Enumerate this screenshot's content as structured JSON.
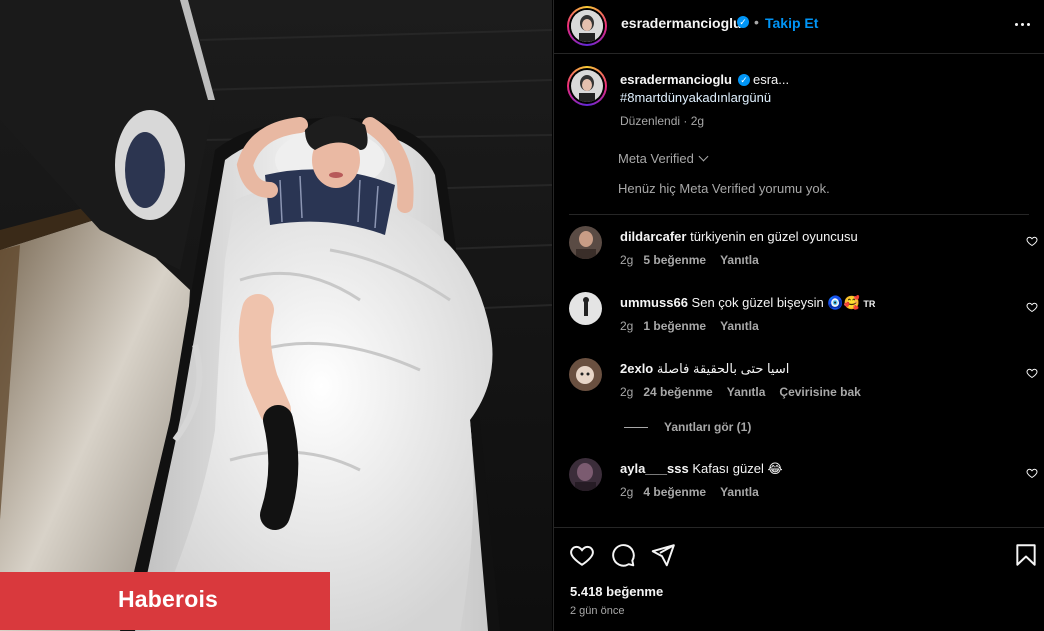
{
  "watermark": {
    "label": "Haberois"
  },
  "post": {
    "username": "esradermancioglu",
    "follow_label": "Takip Et",
    "caption_rest": "esra...",
    "hashtag": "#8martdünyakadınlargünü",
    "edited": "Düzenlendi · 2g",
    "meta_verified_label": "Meta Verified",
    "meta_verified_empty": "Henüz hiç Meta Verified yorumu yok.",
    "likes": "5.418 beğenme",
    "time_ago": "2 gün önce"
  },
  "comments": [
    {
      "user": "dildarcafer",
      "text": "türkiyenin en güzel oyuncusu",
      "time": "2g",
      "likes": "5 beğenme",
      "reply": "Yanıtla"
    },
    {
      "user": "ummuss66",
      "text": "Sen çok güzel bişeysin 🧿🥰",
      "flag": "TR",
      "time": "2g",
      "likes": "1 beğenme",
      "reply": "Yanıtla"
    },
    {
      "user": "2exlo",
      "text": "اسيا حتى بالحقيقة فاصلة",
      "time": "2g",
      "likes": "24 beğenme",
      "reply": "Yanıtla",
      "translate": "Çevirisine bak",
      "view_replies": "Yanıtları gör (1)"
    },
    {
      "user": "ayla___sss",
      "text": "Kafası güzel 😂",
      "time": "2g",
      "likes": "4 beğenme",
      "reply": "Yanıtla"
    }
  ],
  "icons": {
    "like": "heart-icon",
    "comment": "comment-icon",
    "share": "send-icon",
    "save": "bookmark-icon",
    "more": "more-icon"
  },
  "colors": {
    "accent": "#0095f6",
    "watermark": "#d9393d",
    "background": "#000000"
  }
}
